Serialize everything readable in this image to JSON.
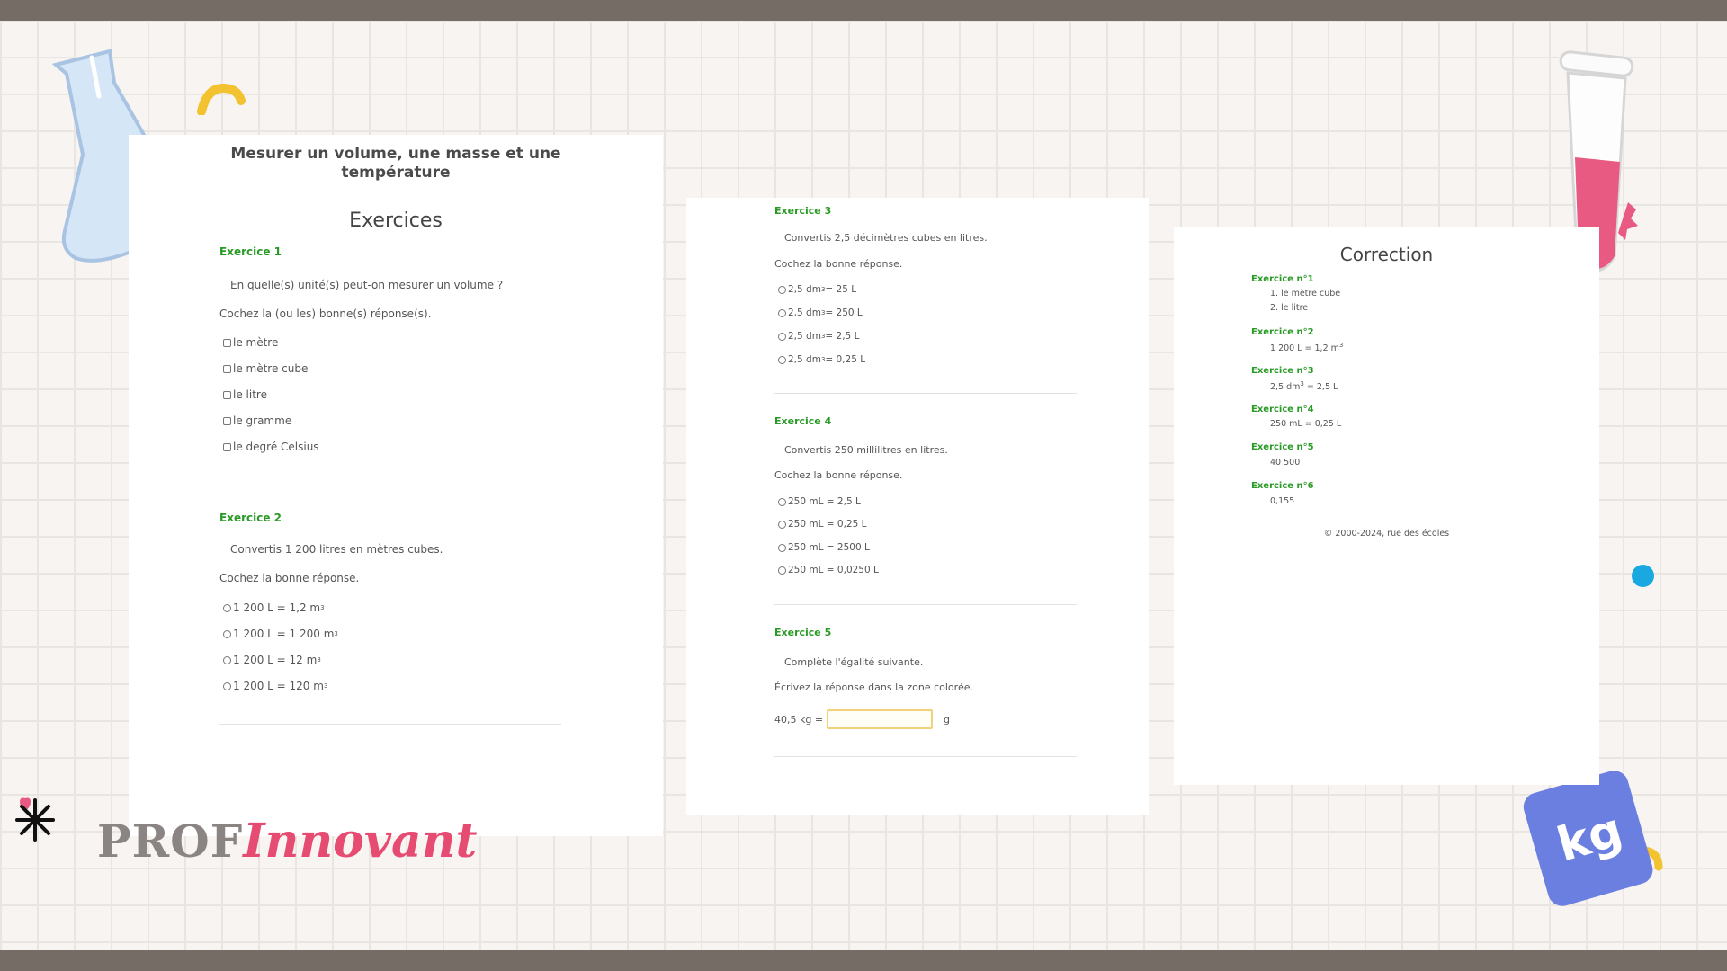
{
  "colors": {
    "frame": "#756d65",
    "exercise_title": "#2a9a26",
    "logo_pink": "#e64b72",
    "kg_tag": "#6b7fe0",
    "dot": "#1aa8e0",
    "input_border": "#f0d27a"
  },
  "icons": [
    "flask-icon",
    "test-tube-icon",
    "kg-weight-tag-icon",
    "asterisk-icon",
    "yellow-arc-shape",
    "blue-dot-shape"
  ],
  "page1": {
    "title_line1": "Mesurer un volume, une masse et une",
    "title_line2": "température",
    "section": "Exercices",
    "ex1": {
      "title": "Exercice 1",
      "question": "En quelle(s) unité(s) peut-on mesurer un volume ?",
      "instruction": "Cochez la (ou les) bonne(s) réponse(s).",
      "options": [
        "le mètre",
        "le mètre cube",
        "le litre",
        "le gramme",
        "le degré Celsius"
      ]
    },
    "ex2": {
      "title": "Exercice 2",
      "question": "Convertis 1 200 litres en mètres cubes.",
      "instruction": "Cochez la bonne réponse.",
      "options": [
        "1 200 L = 1,2 m",
        "1 200 L = 1 200 m",
        "1 200 L = 12 m",
        "1 200 L = 120 m"
      ],
      "unit_exponent": "3"
    }
  },
  "page2": {
    "ex3": {
      "title": "Exercice 3",
      "question": "Convertis 2,5 décimètres cubes en litres.",
      "instruction": "Cochez la bonne réponse.",
      "option_prefix": "2,5 dm",
      "exponent": "3",
      "option_suffixes": [
        " = 25 L",
        " = 250 L",
        " = 2,5 L",
        " = 0,25 L"
      ]
    },
    "ex4": {
      "title": "Exercice 4",
      "question": "Convertis 250 millilitres en litres.",
      "instruction": "Cochez la bonne réponse.",
      "options": [
        "250 mL = 2,5 L",
        "250 mL = 0,25 L",
        "250 mL = 2500 L",
        "250 mL = 0,0250 L"
      ]
    },
    "ex5": {
      "title": "Exercice 5",
      "question": "Complète l'égalité suivante.",
      "instruction": "Écrivez la réponse dans la zone colorée.",
      "input_label": "40,5 kg =",
      "input_value": "",
      "input_unit": "g"
    }
  },
  "page3": {
    "title": "Correction",
    "items": [
      {
        "title": "Exercice n°1",
        "lines": [
          "1. le mètre cube",
          "2. le litre"
        ]
      },
      {
        "title": "Exercice n°2",
        "lines": [
          "1 200 L = 1,2 m"
        ],
        "exponent": "3"
      },
      {
        "title": "Exercice n°3",
        "lines": [
          "2,5 dm"
        ],
        "exponent": "3",
        "after": " = 2,5 L"
      },
      {
        "title": "Exercice n°4",
        "lines": [
          "250 mL = 0,25 L"
        ]
      },
      {
        "title": "Exercice n°5",
        "lines": [
          "40 500"
        ]
      },
      {
        "title": "Exercice n°6",
        "lines": [
          "0,155"
        ]
      }
    ],
    "copyright": "© 2000-2024, rue des écoles"
  },
  "logo": {
    "part1": "PROF",
    "part2": "Innovant"
  },
  "kg_label": "kg"
}
